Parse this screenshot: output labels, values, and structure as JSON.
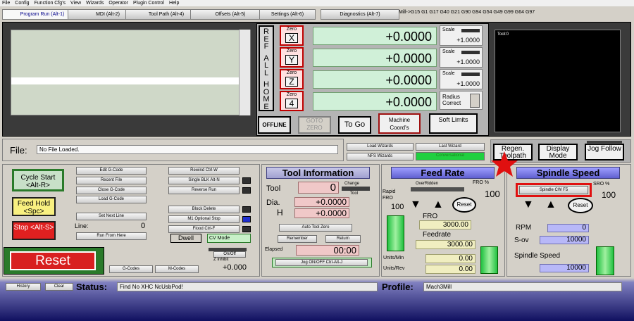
{
  "menu": [
    "File",
    "Config",
    "Function Cfg's",
    "View",
    "Wizards",
    "Operator",
    "Plugin Control",
    "Help"
  ],
  "tabs": [
    "Program Run (Alt-1)",
    "MDI (Alt-2)",
    "Tool Path (Alt-4)",
    "Offsets (Alt-5)",
    "Settings (Alt-6)",
    "Diagnostics (Alt-7)"
  ],
  "gcodes": "Mill->G15  G1 G17 G40 G21 G90 G94 G54 G49 G99 G64 G97",
  "ref_all_home": [
    "R",
    "E",
    "F",
    "",
    "A",
    "L",
    "L",
    "",
    "H",
    "O",
    "M",
    "E"
  ],
  "axes": [
    {
      "zero": "Zero",
      "letter": "X",
      "value": "+0.0000"
    },
    {
      "zero": "Zero",
      "letter": "Y",
      "value": "+0.0000"
    },
    {
      "zero": "Zero",
      "letter": "Z",
      "value": "+0.0000"
    },
    {
      "zero": "Zero",
      "letter": "4",
      "value": "+0.0000"
    }
  ],
  "scale": {
    "label": "Scale",
    "x": "+1.0000",
    "y": "+1.0000",
    "z": "+1.0000"
  },
  "radius_correct": "Radius Correct",
  "offline": "OFFLINE",
  "goto_zero": "GOTO ZERO",
  "to_go": "To Go",
  "machine_coords": "Machine Coord's",
  "soft_limits": "Soft Limits",
  "toolpath_label": "Tool:0",
  "file": {
    "label": "File:",
    "value": "No File Loaded."
  },
  "wizards": {
    "load": "Load Wizards",
    "last": "Last Wizard",
    "nfs": "NFS Wizards",
    "conv": "Conversational"
  },
  "view": {
    "regen": "Regen. Toolpath",
    "display": "Display Mode",
    "jog": "Jog Follow"
  },
  "left": {
    "cycle": "Cycle Start <Alt-R>",
    "feedhold": "Feed Hold <Spc>",
    "stop": "Stop <Alt-S>",
    "reset": "Reset",
    "edit": "Edit G-Code",
    "recent": "Recent File",
    "close": "Close G-Code",
    "load": "Load G-Code",
    "setnext": "Set Next Line",
    "line": "Line:",
    "line_val": "0",
    "runfrom": "Run From Here",
    "rewind": "Rewind Ctrl-W",
    "single": "Single BLK Alt-N",
    "reverse": "Reverse Run",
    "blockdel": "Block Delete",
    "m1": "M1 Optional Stop",
    "flood": "Flood Ctrl-F",
    "dwell": "Dwell",
    "cvmode": "CV Mode",
    "onoff": "On/Off",
    "zinhibit": "Z Inhibit",
    "zval": "+0.000",
    "gcodes": "G-Codes",
    "mcodes": "M-Codes"
  },
  "toolinfo": {
    "title": "Tool Information",
    "tool": "Tool",
    "tool_val": "0",
    "change": "Change",
    "tool2": "Tool",
    "dia": "Dia.",
    "dia_val": "+0.0000",
    "h": "H",
    "h_val": "+0.0000",
    "autozero": "Auto Tool Zero",
    "remember": "Remember",
    "return": "Return",
    "elapsed": "Elapsed",
    "elapsed_val": "00:00",
    "jog": "Jog ON/OFF Ctrl-Alt-J"
  },
  "feed": {
    "title": "Feed Rate",
    "overridden": "OverRidden",
    "fro_pct": "FRO %",
    "fro_val": "100",
    "rapid": "Rapid FRO",
    "rapid_val": "100",
    "reset": "Reset",
    "fro": "FRO",
    "fro_num": "3000.00",
    "feedrate": "Feedrate",
    "feedrate_val": "3000.00",
    "upm": "Units/Min",
    "upm_val": "0.00",
    "upr": "Units/Rev",
    "upr_val": "0.00"
  },
  "spindle": {
    "title": "Spindle Speed",
    "cw": "Spindle CW F5",
    "sro": "SRO %",
    "sro_val": "100",
    "reset": "Reset",
    "rpm": "RPM",
    "rpm_val": "0",
    "sov": "S-ov",
    "sov_val": "10000",
    "speed": "Spindle Speed",
    "speed_val": "10000"
  },
  "status": {
    "history": "History",
    "clear": "Clear",
    "label": "Status:",
    "value": "Find No XHC NcUsbPod!",
    "profile_label": "Profile:",
    "profile": "Mach3Mill"
  },
  "colors": {
    "bg": "#d4d0c8",
    "dro": "#d0f0d8",
    "accent_red": "#e01010"
  }
}
